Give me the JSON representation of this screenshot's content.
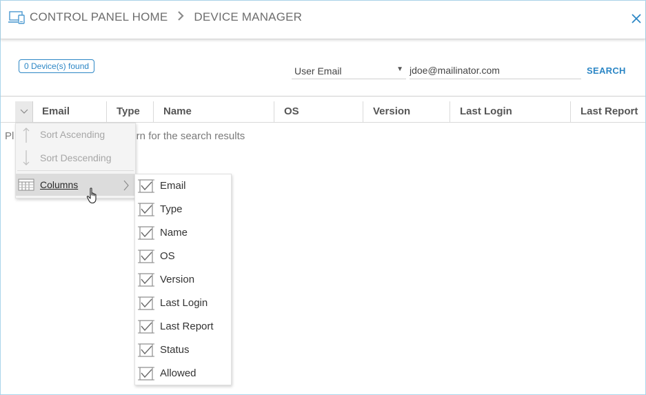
{
  "header": {
    "breadcrumb": [
      "CONTROL PANEL HOME",
      "DEVICE MANAGER"
    ]
  },
  "search": {
    "found_label": "0 Device(s) found",
    "field_selected": "User Email",
    "query_value": "jdoe@mailinator.com",
    "search_label": "SEARCH"
  },
  "grid": {
    "columns": [
      "Email",
      "Type",
      "Name",
      "OS",
      "Version",
      "Last Login",
      "Last Report"
    ],
    "empty_message_left": "Pl",
    "empty_message_right": "ern for the search results"
  },
  "column_menu": {
    "items": [
      {
        "label": "Sort Ascending",
        "icon": "sort-ascending-icon",
        "disabled": true
      },
      {
        "label": "Sort Descending",
        "icon": "sort-descending-icon",
        "disabled": true
      },
      {
        "label": "Columns",
        "icon": "columns-icon",
        "disabled": false
      }
    ]
  },
  "columns_submenu": {
    "items": [
      {
        "label": "Email",
        "checked": true
      },
      {
        "label": "Type",
        "checked": true
      },
      {
        "label": "Name",
        "checked": true
      },
      {
        "label": "OS",
        "checked": true
      },
      {
        "label": "Version",
        "checked": true
      },
      {
        "label": "Last Login",
        "checked": true
      },
      {
        "label": "Last Report",
        "checked": true
      },
      {
        "label": "Status",
        "checked": true
      },
      {
        "label": "Allowed",
        "checked": true
      }
    ]
  },
  "colors": {
    "accent": "#2b86c5",
    "border": "#a9d4ea"
  }
}
